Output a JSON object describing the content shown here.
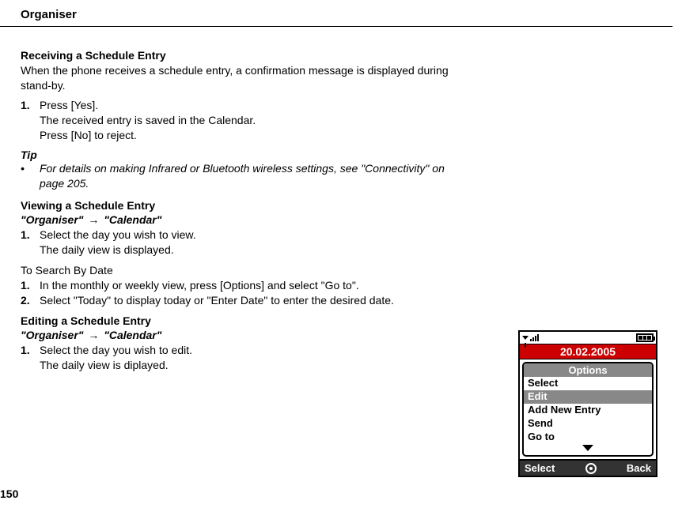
{
  "header": "Organiser",
  "page_number": "150",
  "receiving": {
    "title": "Receiving a Schedule Entry",
    "intro_line1": "When the phone receives a schedule entry, a confirmation message is displayed during",
    "intro_line2": "stand-by.",
    "step_num": "1.",
    "step_text": "Press [Yes].",
    "sub1": "The received entry is saved in the Calendar.",
    "sub2": "Press [No] to reject."
  },
  "tip": {
    "label": "Tip",
    "bullet": "•",
    "line1": "For details on making Infrared or Bluetooth wireless settings, see \"Connectivity\" on",
    "line2": "page 205."
  },
  "viewing": {
    "title": "Viewing a Schedule Entry",
    "crumb1": "\"Organiser\"",
    "crumb2": "\"Calendar\"",
    "step_num": "1.",
    "step_text": "Select the day you wish to view.",
    "sub": "The daily view is displayed."
  },
  "search": {
    "heading": "To Search By Date",
    "s1_num": "1.",
    "s1_text": "In the monthly or weekly view, press [Options] and select \"Go to\".",
    "s2_num": "2.",
    "s2_text": "Select \"Today\" to display today or \"Enter Date\" to enter the desired date."
  },
  "editing": {
    "title": "Editing a Schedule Entry",
    "crumb1": "\"Organiser\"",
    "crumb2": "\"Calendar\"",
    "step_num": "1.",
    "step_text": "Select the day you wish to edit.",
    "sub": "The daily view is diplayed."
  },
  "arrow": "→",
  "phone": {
    "date": "20.02.2005",
    "menu_title": "Options",
    "items": {
      "i0": "Select",
      "i1": "Edit",
      "i2": "Add New Entry",
      "i3": "Send",
      "i4": "Go to"
    },
    "soft_left": "Select",
    "soft_right": "Back"
  }
}
